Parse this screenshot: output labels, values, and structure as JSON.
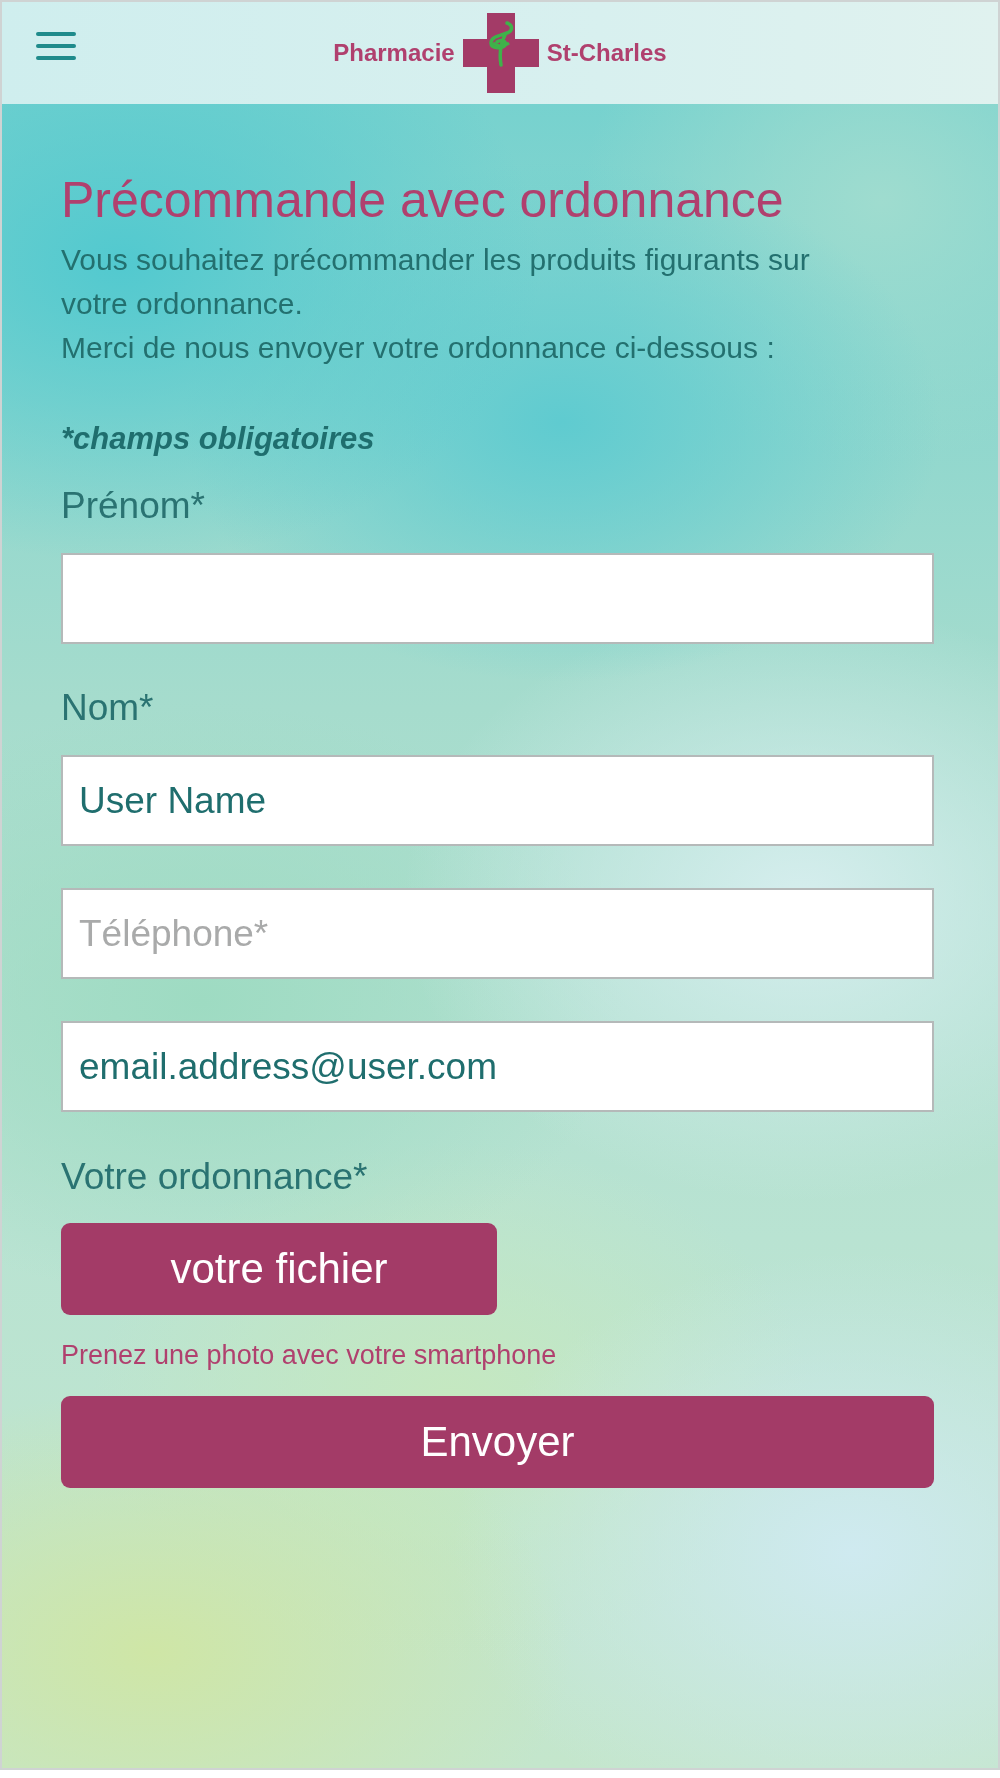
{
  "header": {
    "brand_left": "Pharmacie",
    "brand_right": "St-Charles"
  },
  "intro": {
    "title": "Précommande avec ordonnance",
    "paragraphs": [
      "Vous souhaitez précommander les produits figurants sur votre ordonnance.",
      "Merci de nous envoyer votre ordonnance ci-dessous :"
    ],
    "required_note": "*champs obligatoires"
  },
  "fields": [
    {
      "label": "Prénom*"
    },
    {
      "label": "Nom*",
      "value": "User Name"
    },
    {
      "placeholder": "Téléphone*"
    },
    {
      "value": "email.address@user.com"
    }
  ],
  "upload": {
    "label": "Votre ordonnance*",
    "button": "votre fichier",
    "hint": "Prenez une photo avec votre smartphone"
  },
  "submit": "Envoyer"
}
